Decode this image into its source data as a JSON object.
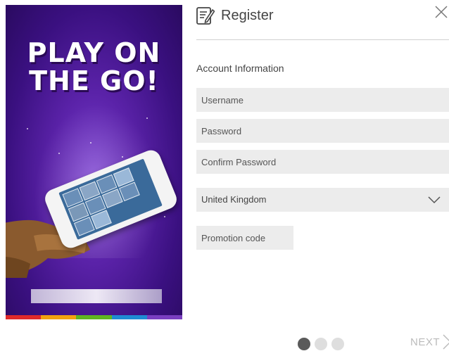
{
  "promo": {
    "headline_line1": "PLAY ON",
    "headline_line2": "THE GO!",
    "stripe_colors": [
      "#e02a2a",
      "#f2a20f",
      "#5fb521",
      "#1f8bd2",
      "#7a3fc0"
    ]
  },
  "header": {
    "title": "Register",
    "icon": "register-form-icon",
    "close_icon": "close-icon"
  },
  "form": {
    "section_label": "Account Information",
    "username_placeholder": "Username",
    "password_placeholder": "Password",
    "confirm_password_placeholder": "Confirm Password",
    "country_value": "United Kingdom",
    "promotion_code_placeholder": "Promotion code"
  },
  "pagination": {
    "steps": 3,
    "current_step": 1
  },
  "footer": {
    "next_label": "NEXT"
  },
  "colors": {
    "field_bg": "#ececec",
    "dot_active": "#5a5a5a",
    "dot_inactive": "#dedede",
    "next_text": "#bbbbbb"
  }
}
